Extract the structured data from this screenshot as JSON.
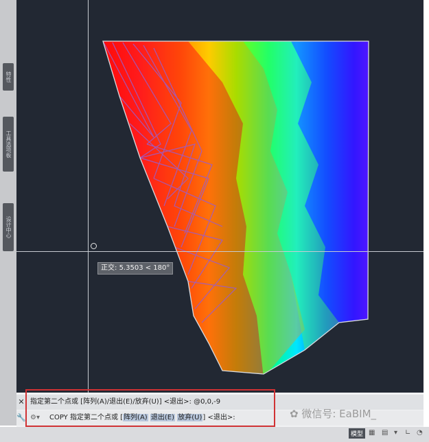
{
  "palette": {
    "tabs": [
      "特性",
      "工具选项板",
      "设计中心"
    ]
  },
  "viewport": {
    "tooltip_label": "正交:",
    "tooltip_value": "5.3503 < 180°"
  },
  "command_line": {
    "row1": {
      "close_icon": "close-icon",
      "text": "指定第二个点或 [阵列(A)/退出(E)/放弃(U)] <退出>: @0,0,-9"
    },
    "row2": {
      "wrench_icon": "wrench-icon",
      "command": "COPY",
      "prompt": "指定第二个点或",
      "opt_bracket_open": "[",
      "opt1": "阵列(A)",
      "opt2": "退出(E)",
      "opt3": "放弃(U)",
      "opt_bracket_close": "]",
      "suffix": "<退出>:"
    }
  },
  "watermark": "微信号: EaBIM_",
  "status_bar": {
    "model_label": "模型"
  },
  "colors": {
    "viewport_bg": "#222833",
    "highlight": "#d03234"
  }
}
